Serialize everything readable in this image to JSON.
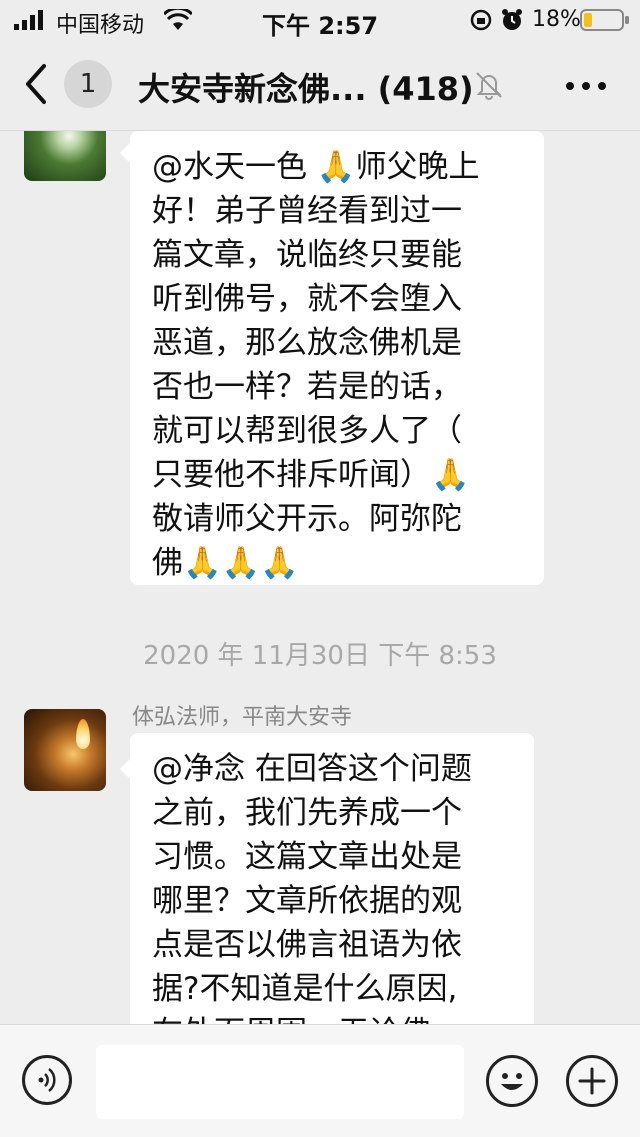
{
  "status_bar": {
    "carrier": "中国移动",
    "time": "下午 2:57",
    "battery": "18%"
  },
  "nav": {
    "unread_count": "1",
    "title": "大安寺新念佛... (418)",
    "icons": {
      "back": "chevron-left-icon",
      "mute": "bell-off-icon",
      "more": "more-dots-icon"
    }
  },
  "messages": [
    {
      "lines": [
        "@水天一色 🙏师父晚上",
        "好！弟子曾经看到过一",
        "篇文章，说临终只要能",
        "听到佛号，就不会堕入",
        "恶道，那么放念佛机是",
        "否也一样？若是的话，",
        "就可以帮到很多人了（",
        "只要他不排斥听闻）🙏",
        "敬请师父开示。阿弥陀",
        "佛🙏🙏🙏"
      ]
    },
    {
      "sender": "体弘法师，平南大安寺",
      "lines": [
        "@净念 在回答这个问题",
        "之前，我们先养成一个",
        "习惯。这篇文章出处是",
        "哪里？文章所依据的观",
        "点是否以佛言祖语为依",
        "据?不知道是什么原因,",
        "在外面周围，无论佛"
      ]
    }
  ],
  "timestamp": "2020 年 11月30日 下午 8:53",
  "input_bar": {
    "placeholder": "",
    "icons": {
      "voice": "voice-icon",
      "emoji": "emoji-icon",
      "plus": "plus-icon"
    }
  }
}
